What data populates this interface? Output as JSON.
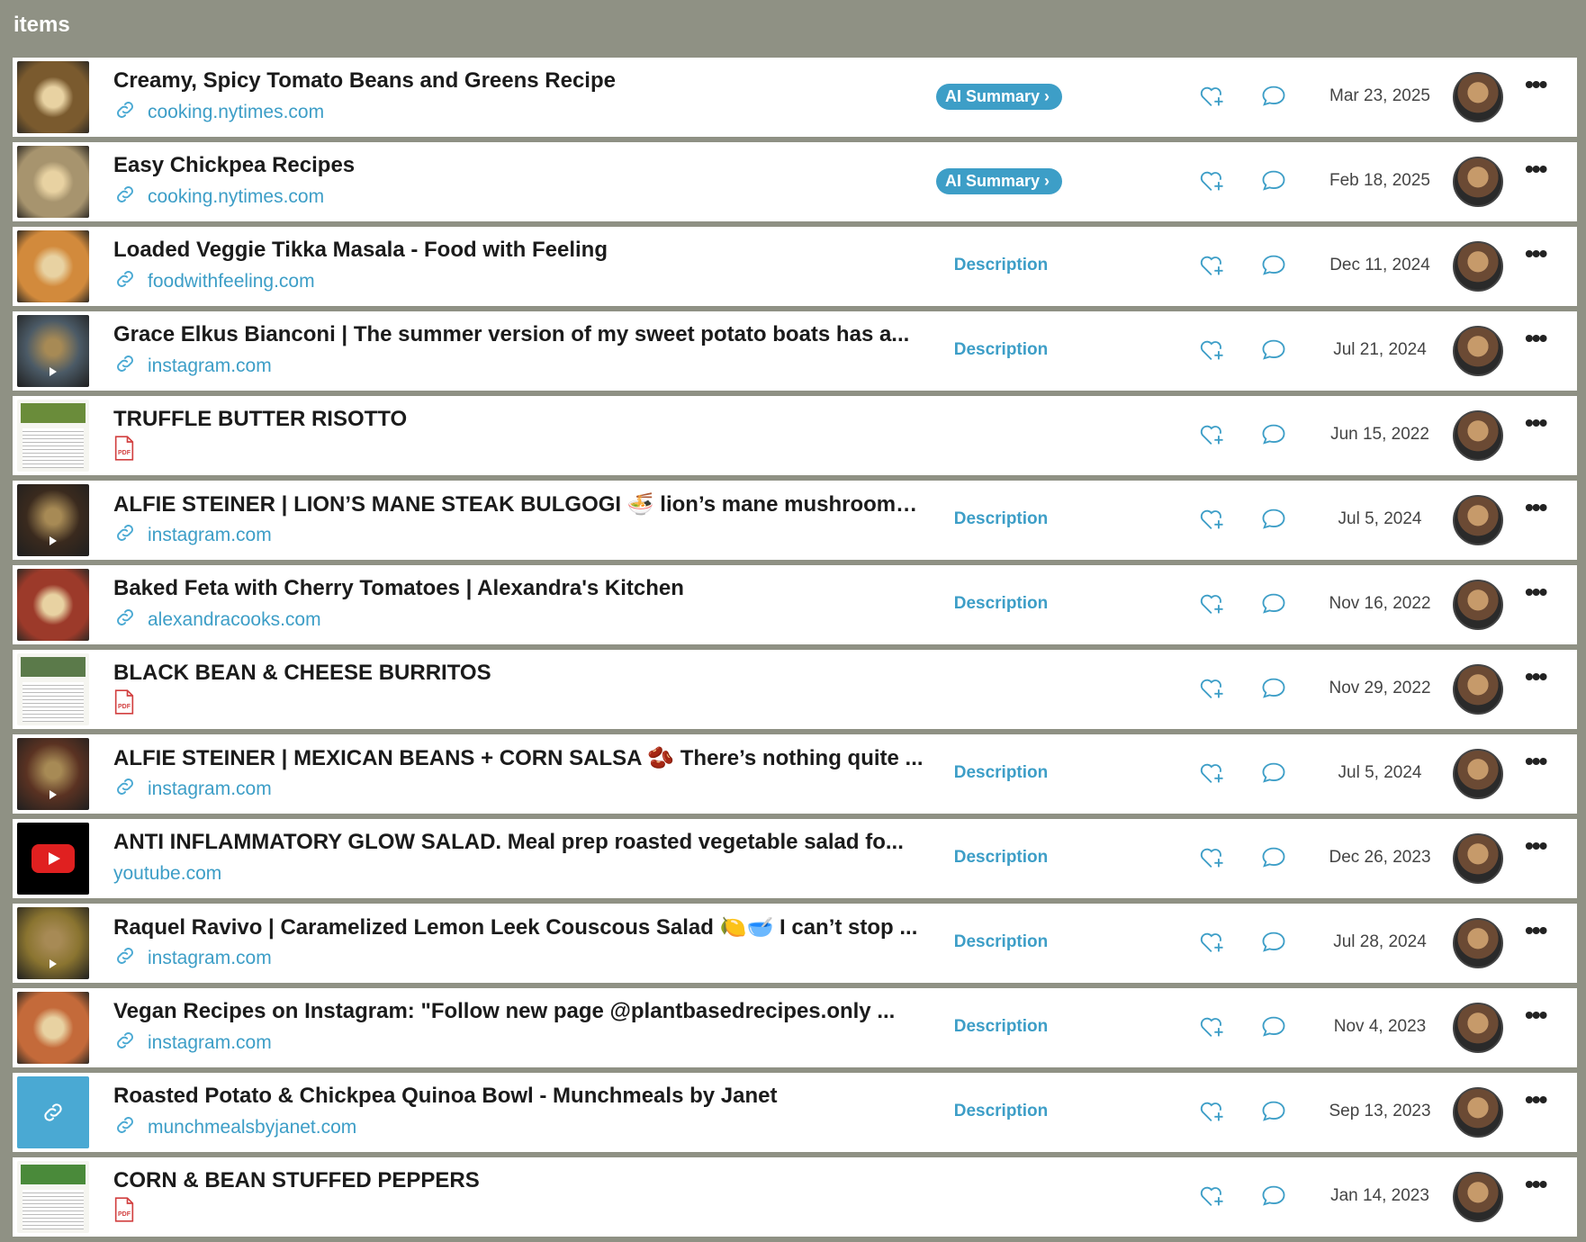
{
  "header": {
    "title": "items"
  },
  "ai_summary_label": "AI Summary",
  "description_label": "Description",
  "items": [
    {
      "title": "Creamy, Spicy Tomato Beans and Greens  Recipe",
      "source": "cooking.nytimes.com",
      "source_type": "link",
      "action": "ai",
      "date": "Mar 23, 2025",
      "thumb": "food",
      "thumb_color": "#7a5a2e"
    },
    {
      "title": "Easy Chickpea Recipes",
      "source": "cooking.nytimes.com",
      "source_type": "link",
      "action": "ai",
      "date": "Feb 18, 2025",
      "thumb": "food",
      "thumb_color": "#a7946e"
    },
    {
      "title": "Loaded Veggie Tikka Masala - Food with Feeling",
      "source": "foodwithfeeling.com",
      "source_type": "link",
      "action": "desc",
      "date": "Dec 11, 2024",
      "thumb": "food",
      "thumb_color": "#d28a3c"
    },
    {
      "title": "Grace Elkus Bianconi | The summer version of my sweet potato boats has a...",
      "source": "instagram.com",
      "source_type": "link",
      "action": "desc",
      "date": "Jul 21, 2024",
      "thumb": "video",
      "thumb_color": "#4b5a66"
    },
    {
      "title": "TRUFFLE BUTTER RISOTTO",
      "source": "",
      "source_type": "pdf",
      "action": "none",
      "date": "Jun 15, 2022",
      "thumb": "doc",
      "thumb_color": "#6a8c3a"
    },
    {
      "title": "ALFIE STEINER | LION’S MANE STEAK BULGOGI 🍜 lion’s mane mushrooms ...",
      "source": "instagram.com",
      "source_type": "link",
      "action": "desc",
      "date": "Jul 5, 2024",
      "thumb": "video",
      "thumb_color": "#3a2a1e"
    },
    {
      "title": "Baked Feta with Cherry Tomatoes | Alexandra's Kitchen",
      "source": "alexandracooks.com",
      "source_type": "link",
      "action": "desc",
      "date": "Nov 16, 2022",
      "thumb": "food",
      "thumb_color": "#9c3a2a"
    },
    {
      "title": "BLACK BEAN & CHEESE BURRITOS",
      "source": "",
      "source_type": "pdf",
      "action": "none",
      "date": "Nov 29, 2022",
      "thumb": "doc",
      "thumb_color": "#5b7a4a"
    },
    {
      "title": "ALFIE STEINER | MEXICAN BEANS + CORN SALSA 🫘 There’s nothing quite ...",
      "source": "instagram.com",
      "source_type": "link",
      "action": "desc",
      "date": "Jul 5, 2024",
      "thumb": "video",
      "thumb_color": "#5a3222"
    },
    {
      "title": "ANTI INFLAMMATORY GLOW SALAD. Meal prep roasted vegetable salad fo...",
      "source": "youtube.com",
      "source_type": "none",
      "action": "desc",
      "date": "Dec 26, 2023",
      "thumb": "youtube",
      "thumb_color": "#000000"
    },
    {
      "title": "Raquel Ravivo | Caramelized Lemon Leek Couscous Salad 🍋🥣 I can’t stop ...",
      "source": "instagram.com",
      "source_type": "link",
      "action": "desc",
      "date": "Jul 28, 2024",
      "thumb": "video",
      "thumb_color": "#8a7430"
    },
    {
      "title": "Vegan Recipes on Instagram: \"Follow new page @plantbasedrecipes.only  ...",
      "source": "instagram.com",
      "source_type": "link",
      "action": "desc",
      "date": "Nov 4, 2023",
      "thumb": "food",
      "thumb_color": "#c46a3a"
    },
    {
      "title": "Roasted Potato & Chickpea Quinoa Bowl - Munchmeals by Janet",
      "source": "munchmealsbyjanet.com",
      "source_type": "link",
      "action": "desc",
      "date": "Sep 13, 2023",
      "thumb": "link",
      "thumb_color": "#4aa9d3"
    },
    {
      "title": "CORN & BEAN STUFFED PEPPERS",
      "source": "",
      "source_type": "pdf",
      "action": "none",
      "date": "Jan 14, 2023",
      "thumb": "doc",
      "thumb_color": "#4a8a3a"
    }
  ]
}
